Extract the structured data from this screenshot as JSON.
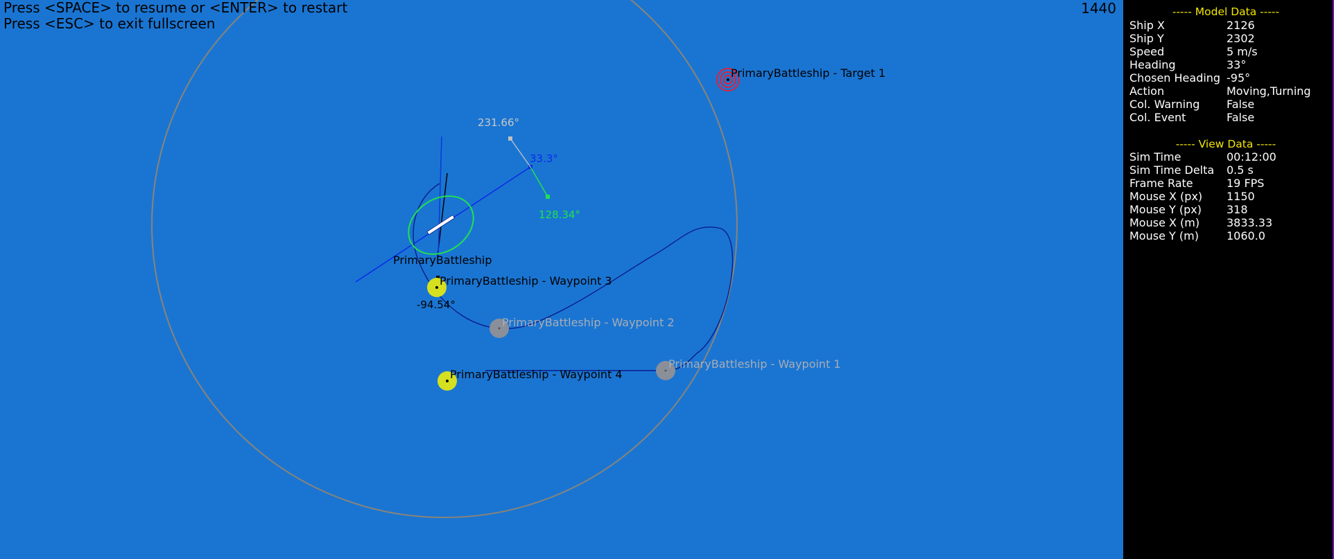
{
  "hud": {
    "line1": "Press <SPACE> to resume or <ENTER> to restart",
    "line2": "Press <ESC> to exit fullscreen",
    "counter": "1440"
  },
  "scene": {
    "ship_label": "PrimaryBattleship",
    "target_label": "PrimaryBattleship - Target 1",
    "waypoints": [
      "PrimaryBattleship - Waypoint 1",
      "PrimaryBattleship - Waypoint 2",
      "PrimaryBattleship - Waypoint 3",
      "PrimaryBattleship - Waypoint 4"
    ],
    "angles": {
      "grey": "231.66°",
      "blue": "33.3°",
      "green": "128.34°",
      "black": "-94.54°"
    }
  },
  "panel": {
    "model_title": "----- Model Data -----",
    "model": [
      {
        "k": "Ship X",
        "v": "2126"
      },
      {
        "k": "Ship Y",
        "v": "2302"
      },
      {
        "k": "Speed",
        "v": "5 m/s"
      },
      {
        "k": "Heading",
        "v": "33°"
      },
      {
        "k": "Chosen Heading",
        "v": "-95°"
      },
      {
        "k": "Action",
        "v": "Moving,Turning"
      },
      {
        "k": "Col. Warning",
        "v": "False"
      },
      {
        "k": "Col. Event",
        "v": "False"
      }
    ],
    "view_title": "----- View Data -----",
    "view": [
      {
        "k": "Sim Time",
        "v": "00:12:00"
      },
      {
        "k": "Sim Time Delta",
        "v": "0.5 s"
      },
      {
        "k": "Frame Rate",
        "v": "19 FPS"
      },
      {
        "k": "Mouse X (px)",
        "v": "1150"
      },
      {
        "k": "Mouse Y (px)",
        "v": "318"
      },
      {
        "k": "Mouse X (m)",
        "v": "3833.33"
      },
      {
        "k": "Mouse Y (m)",
        "v": "1060.0"
      }
    ]
  },
  "colors": {
    "water": "#1a75d2",
    "active_waypoint": "#d4e020",
    "passed_waypoint": "#8a8f99",
    "target": "#e0213a",
    "panel_title": "#f2e600",
    "ship_outline": "#22e050"
  }
}
